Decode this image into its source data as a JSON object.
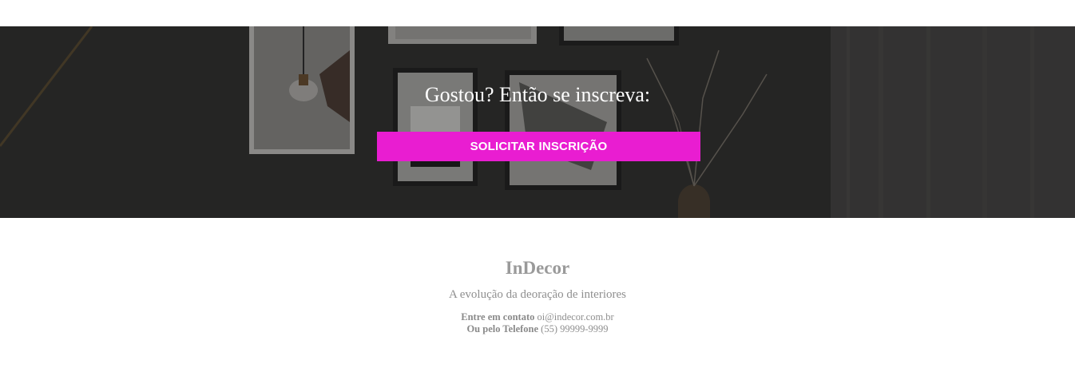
{
  "hero": {
    "title": "Gostou? Então se inscreva:",
    "cta_label": "SOLICITAR INSCRIÇÃO",
    "accent_color": "#e91dd1"
  },
  "footer": {
    "brand": "InDecor",
    "tagline": "A evolução da deoração de interiores",
    "contact_email_label": "Entre em contato",
    "contact_email": "oi@indecor.com.br",
    "contact_phone_label": "Ou pelo Telefone",
    "contact_phone": "(55) 99999-9999"
  }
}
